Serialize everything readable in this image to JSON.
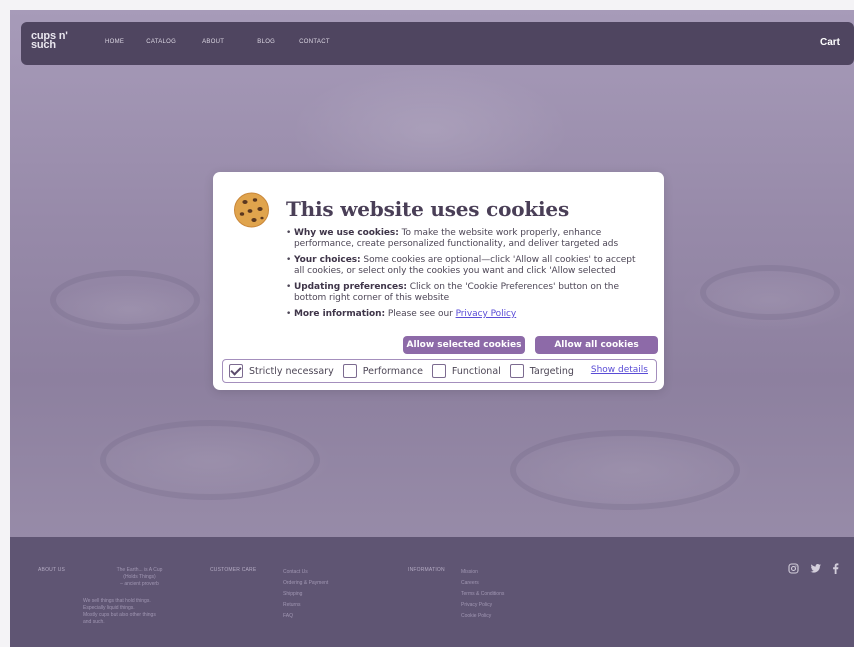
{
  "brand": {
    "logo_line1": "cups n'",
    "logo_line2": "such"
  },
  "nav": {
    "links": [
      "HOME",
      "CATALOG",
      "ABOUT",
      "BLOG",
      "CONTACT"
    ],
    "cart": "Cart"
  },
  "dialog": {
    "title": "This website uses cookies",
    "bullets": [
      {
        "label": "Why we use cookies:",
        "text": " To make the website work properly, enhance performance, create personalized functionality, and deliver targeted ads"
      },
      {
        "label": "Your choices:",
        "text": " Some cookies are optional—click 'Allow all cookies' to accept all cookies, or select only the cookies you want and click 'Allow selected"
      },
      {
        "label": "Updating preferences:",
        "text": " Click on the 'Cookie Preferences' button on the bottom right corner of this website"
      },
      {
        "label": "More information:",
        "text": " Please see our ",
        "link": "Privacy Policy"
      }
    ],
    "allow_selected": "Allow selected cookies",
    "allow_all": "Allow all cookies",
    "options": [
      {
        "label": "Strictly necessary",
        "checked": true
      },
      {
        "label": "Performance",
        "checked": false
      },
      {
        "label": "Functional",
        "checked": false
      },
      {
        "label": "Targeting",
        "checked": false
      }
    ],
    "show_details": "Show details",
    "icon": "cookie-icon"
  },
  "footer": {
    "about_head": "ABOUT US",
    "quote": [
      "The Earth... is A Cup",
      "(Holds Things)",
      "– ancient proverb"
    ],
    "about_text": [
      "We sell things that hold things.",
      "Especially liquid things.",
      "Mostly cups but also other things",
      "and such."
    ],
    "care_head": "CUSTOMER CARE",
    "care_links": [
      "Contact Us",
      "Ordering & Payment",
      "Shipping",
      "Returns",
      "FAQ"
    ],
    "info_head": "INFORMATION",
    "info_links": [
      "Mission",
      "Careers",
      "Terms & Conditions",
      "Privacy Policy",
      "Cookie Policy"
    ],
    "social_icons": [
      "instagram-icon",
      "twitter-icon",
      "facebook-icon"
    ]
  },
  "colors": {
    "nav_bg": "#4f4560",
    "accent": "#8d6aa8",
    "link": "#5a4cd6",
    "footer_bg": "#5f5573"
  }
}
